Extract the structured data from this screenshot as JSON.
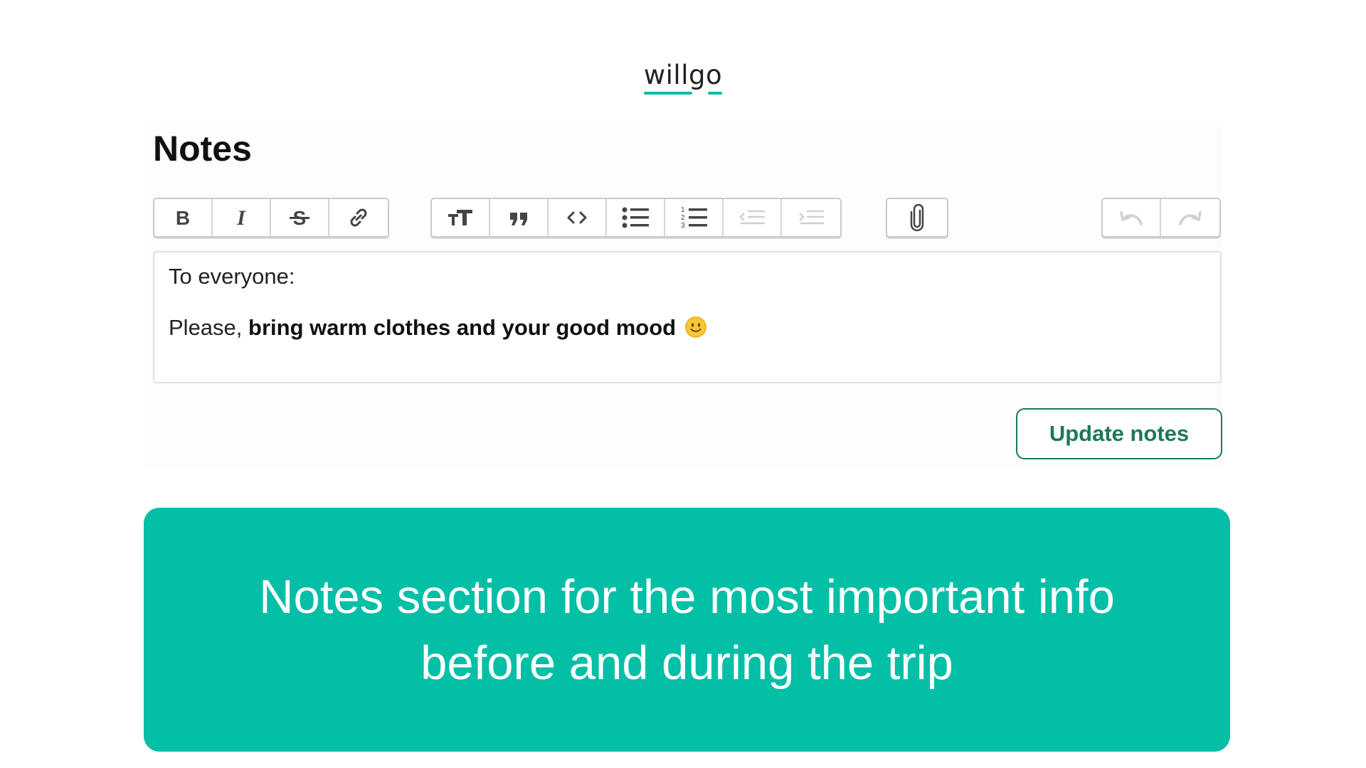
{
  "logo": {
    "text": "willgo",
    "accent_color": "#13b9a2"
  },
  "notes": {
    "title": "Notes",
    "toolbar": {
      "formatting": [
        "bold-icon",
        "italic-icon",
        "strikethrough-icon",
        "link-icon"
      ],
      "blocks": [
        "heading-icon",
        "quote-icon",
        "code-icon",
        "bullet-list-icon",
        "numbered-list-icon",
        "decrease-indent-icon",
        "increase-indent-icon"
      ],
      "attach": [
        "paperclip-icon"
      ],
      "history": [
        "undo-icon",
        "redo-icon"
      ]
    },
    "editor": {
      "line1": "To everyone:",
      "line2_prefix": "Please, ",
      "line2_bold": "bring warm clothes and your good mood"
    },
    "update_button": "Update notes",
    "button_color": "#1b7a55"
  },
  "banner": {
    "text": "Notes section for the most important info before and during the trip",
    "background": "#03bfa6"
  }
}
